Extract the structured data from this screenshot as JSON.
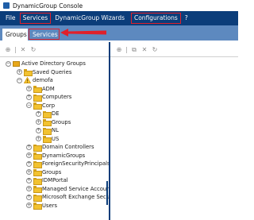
{
  "window": {
    "title": "DynamicGroup Console"
  },
  "menu": {
    "items": [
      "File",
      "Services",
      "DynamicGroup Wizards",
      "Configurations",
      "?"
    ]
  },
  "tabs": {
    "groups": "Groups",
    "services": "Services"
  },
  "toolbar": {
    "left_icons": [
      "add-icon",
      "delete-icon",
      "refresh-icon"
    ],
    "right_icons": [
      "add-icon",
      "copy-icon",
      "delete-icon",
      "refresh-icon"
    ]
  },
  "tree": {
    "root": "Active Directory Groups",
    "saved_queries": "Saved Queries",
    "domain": "demofa",
    "adm": "ADM",
    "computers": "Computers",
    "corp": "Corp",
    "de": "DE",
    "groups_corp": "Groups",
    "nl": "NL",
    "us": "US",
    "domain_controllers": "Domain Controllers",
    "dynamicgroups": "DynamicGroups",
    "fsp": "ForeignSecurityPrincipals",
    "groups": "Groups",
    "idmportal": "IDMPortal",
    "msa": "Managed Service Accounts",
    "exchange": "Microsoft Exchange Security",
    "users": "Users"
  },
  "colors": {
    "menubar": "#0b3d7a",
    "tabbar": "#5d89bf",
    "highlight": "#e0202a",
    "folder": "#f2c230"
  }
}
